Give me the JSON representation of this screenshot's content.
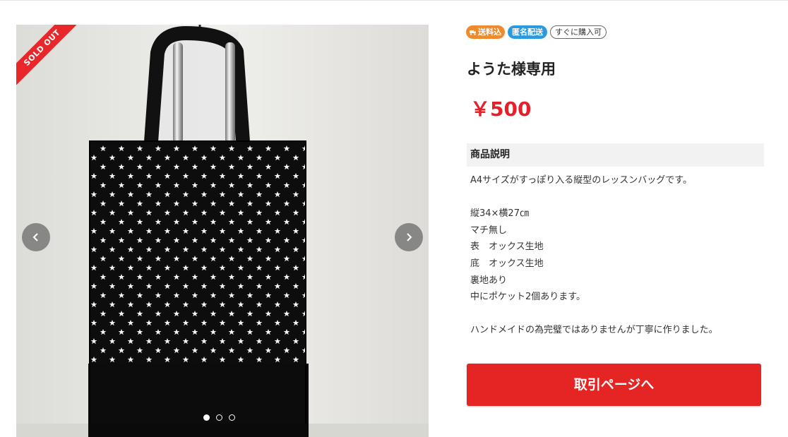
{
  "gallery": {
    "sold_label": "SOLD OUT",
    "image_count": 3,
    "active_index": 0
  },
  "badges": [
    {
      "label": "送料込",
      "color": "#ef8b2c"
    },
    {
      "label": "匿名配送",
      "color": "#2a9ae0"
    },
    {
      "label": "すぐに購入可",
      "color": "#ffffff"
    }
  ],
  "item": {
    "title": "ようた様専用",
    "price": "￥500",
    "price_color": "#e4202b"
  },
  "description": {
    "header": "商品説明",
    "lines": [
      "A4サイズがすっぽり入る縦型のレッスンバッグです。",
      "",
      "縦34×横27㎝",
      "マチ無し",
      "表　オックス生地",
      "底　オックス生地",
      "裏地あり",
      "中にポケット2個あります。",
      "",
      "ハンドメイドの為完璧ではありませんが丁寧に作りました。"
    ]
  },
  "cta": {
    "label": "取引ページへ",
    "color": "#e52424"
  },
  "icons": {
    "prev": "chevron-left-icon",
    "next": "chevron-right-icon",
    "shipping": "truck-icon"
  }
}
